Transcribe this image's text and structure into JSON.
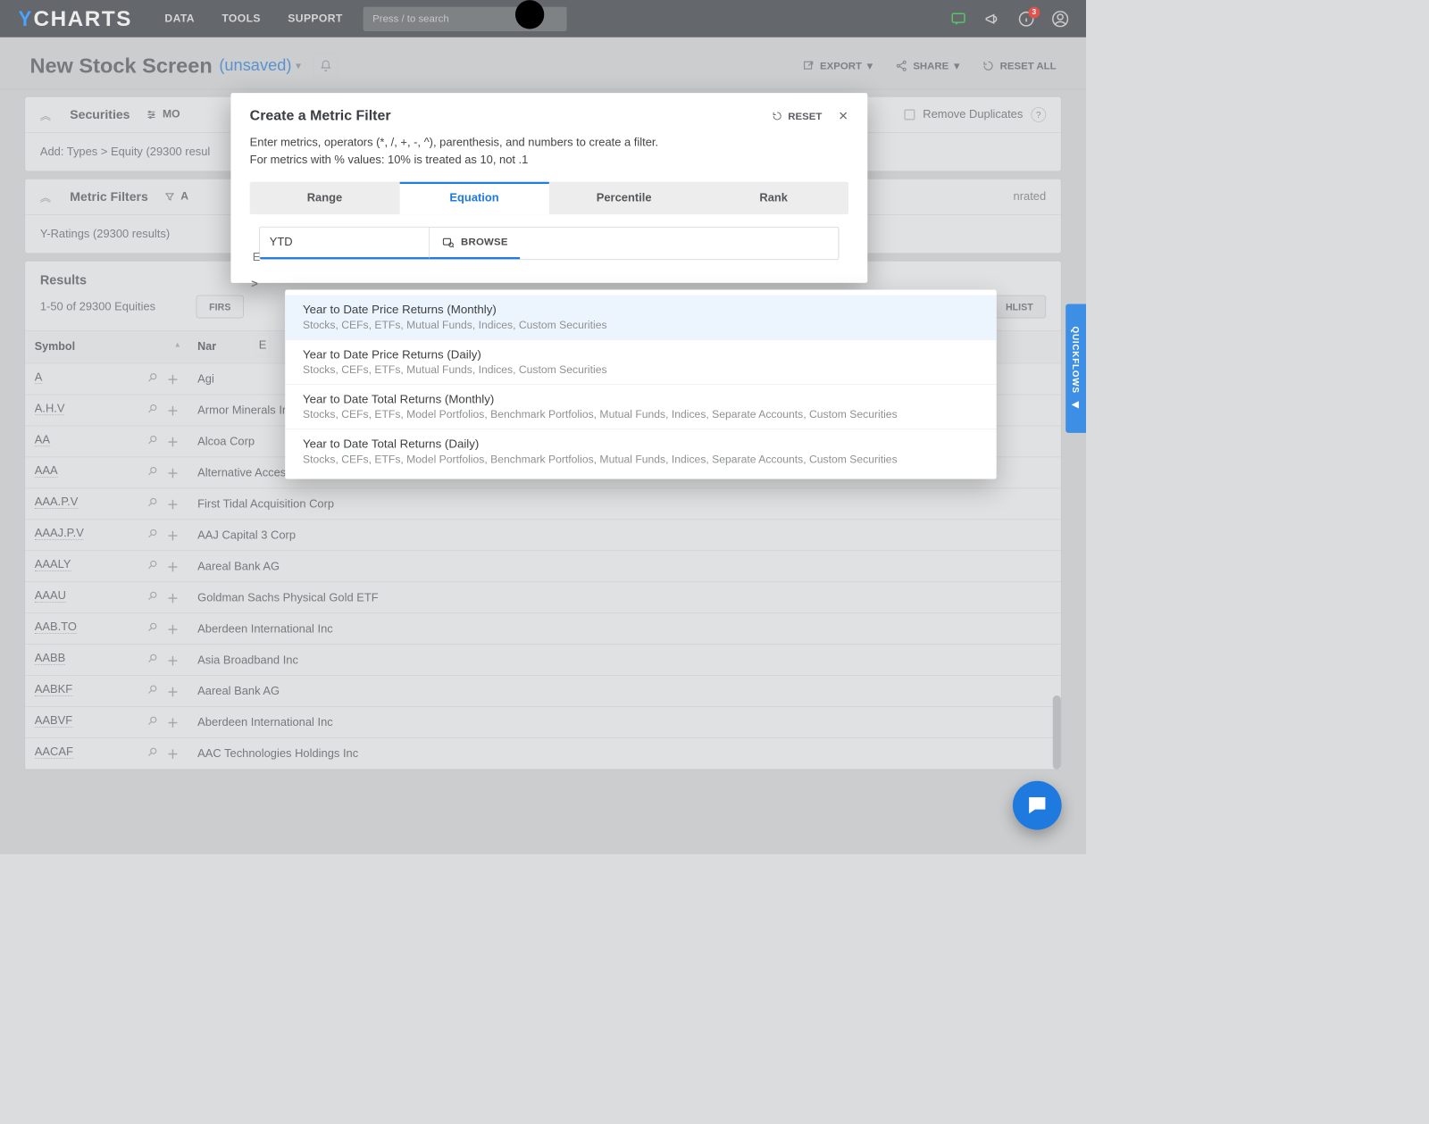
{
  "topbar": {
    "logo": "CHARTS",
    "nav": [
      "DATA",
      "TOOLS",
      "SUPPORT"
    ],
    "search_placeholder": "Press / to search",
    "badge_count": "3"
  },
  "header": {
    "title": "New Stock Screen",
    "unsaved": "(unsaved)",
    "export": "EXPORT",
    "share": "SHARE",
    "reset_all": "RESET ALL"
  },
  "securities": {
    "title": "Securities",
    "modify_cols": "MO",
    "remove_dup": "Remove Duplicates",
    "breadcrumb": "Add: Types > Equity (29300 resul"
  },
  "metric_filters": {
    "title": "Metric Filters",
    "add": "A",
    "yrating": "Y-Ratings (29300 results)",
    "yrating_tail": "nrated"
  },
  "results": {
    "title": "Results",
    "range": "1-50 of 29300 Equities",
    "first": "FIRS",
    "watchlist": "HLIST",
    "columns": {
      "symbol": "Symbol",
      "name": "Nar"
    }
  },
  "rows": [
    {
      "symbol": "A",
      "name": "Agi"
    },
    {
      "symbol": "A.H.V",
      "name": "Armor Minerals Inc"
    },
    {
      "symbol": "AA",
      "name": "Alcoa Corp"
    },
    {
      "symbol": "AAA",
      "name": "Alternative AccessFirstPriorityCLO BdETF"
    },
    {
      "symbol": "AAA.P.V",
      "name": "First Tidal Acquisition Corp"
    },
    {
      "symbol": "AAAJ.P.V",
      "name": "AAJ Capital 3 Corp"
    },
    {
      "symbol": "AAALY",
      "name": "Aareal Bank AG"
    },
    {
      "symbol": "AAAU",
      "name": "Goldman Sachs Physical Gold ETF"
    },
    {
      "symbol": "AAB.TO",
      "name": "Aberdeen International Inc"
    },
    {
      "symbol": "AABB",
      "name": "Asia Broadband Inc"
    },
    {
      "symbol": "AABKF",
      "name": "Aareal Bank AG"
    },
    {
      "symbol": "AABVF",
      "name": "Aberdeen International Inc"
    },
    {
      "symbol": "AACAF",
      "name": "AAC Technologies Holdings Inc"
    }
  ],
  "modal": {
    "title": "Create a Metric Filter",
    "reset": "RESET",
    "desc1": "Enter metrics, operators (*, /, +, -, ^), parenthesis, and numbers to create a filter.",
    "desc2": "For metrics with % values: 10% is treated as 10, not .1",
    "tabs": [
      "Range",
      "Equation",
      "Percentile",
      "Rank"
    ],
    "active_tab": 1,
    "input_value": "YTD",
    "enter_metric_ghost": "E",
    "arrow_ghost": ">",
    "browse": "BROWSE",
    "box_ghost": "E"
  },
  "ac": [
    {
      "title": "Year to Date Price Returns (Monthly)",
      "sub": "Stocks, CEFs, ETFs, Mutual Funds, Indices, Custom Securities",
      "hl": true
    },
    {
      "title": "Year to Date Price Returns (Daily)",
      "sub": "Stocks, CEFs, ETFs, Mutual Funds, Indices, Custom Securities",
      "hl": false
    },
    {
      "title": "Year to Date Total Returns (Monthly)",
      "sub": "Stocks, CEFs, ETFs, Model Portfolios, Benchmark Portfolios, Mutual Funds, Indices, Separate Accounts, Custom Securities",
      "hl": false
    },
    {
      "title": "Year to Date Total Returns (Daily)",
      "sub": "Stocks, CEFs, ETFs, Model Portfolios, Benchmark Portfolios, Mutual Funds, Indices, Separate Accounts, Custom Securities",
      "hl": false
    }
  ],
  "quickflows": "QUICKFLOWS"
}
